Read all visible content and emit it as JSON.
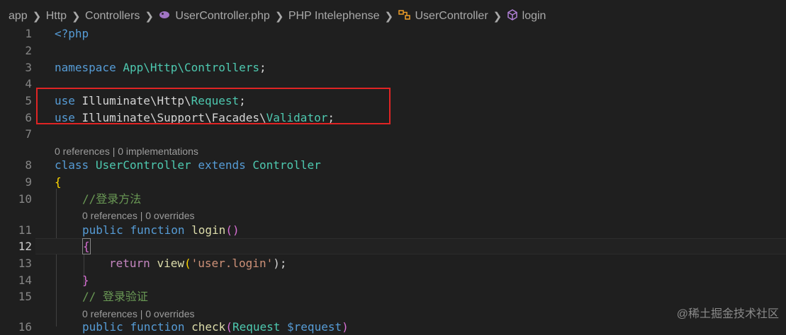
{
  "breadcrumb": {
    "items": [
      "app",
      "Http",
      "Controllers",
      "UserController.php",
      "PHP Intelephense",
      "UserController",
      "login"
    ],
    "separator": ">"
  },
  "lens": {
    "class_lens": "0 references | 0 implementations",
    "login_lens": "0 references | 0 overrides",
    "check_lens": "0 references | 0 overrides"
  },
  "line_numbers": [
    "1",
    "2",
    "3",
    "4",
    "5",
    "6",
    "7",
    "8",
    "9",
    "10",
    "11",
    "12",
    "13",
    "14",
    "15",
    "16"
  ],
  "code": {
    "l1": "<?php",
    "l3_kw": "namespace",
    "l3_ns": "App\\Http\\Controllers",
    "l3_end": ";",
    "l5_kw": "use",
    "l5_ns": "Illuminate\\Http\\",
    "l5_cls": "Request",
    "l5_end": ";",
    "l6_kw": "use",
    "l6_ns": "Illuminate\\Support\\Facades\\",
    "l6_cls": "Validator",
    "l6_end": ";",
    "l8_kw": "class",
    "l8_cls": "UserController",
    "l8_ext": "extends",
    "l8_parent": "Controller",
    "l9": "{",
    "l10": "//登录方法",
    "l11_kw": "public",
    "l11_fn_kw": "function",
    "l11_fn": "login",
    "l11_paren": "()",
    "l12": "{",
    "l13_ret": "return",
    "l13_fn": "view",
    "l13_open": "(",
    "l13_str": "'user.login'",
    "l13_close": ");",
    "l14": "}",
    "l15": "// 登录验证",
    "l16_kw": "public",
    "l16_fn_kw": "function",
    "l16_fn": "check",
    "l16_open": "(",
    "l16_type": "Request",
    "l16_var": "$request",
    "l16_close": ")"
  },
  "watermark": "@稀土掘金技术社区",
  "colors": {
    "background": "#1f1f1f",
    "keyword": "#569cd6",
    "type": "#4ec9b0",
    "function": "#dcdcaa",
    "string": "#ce9178",
    "comment": "#6a9955",
    "highlight_box": "#e02424"
  }
}
